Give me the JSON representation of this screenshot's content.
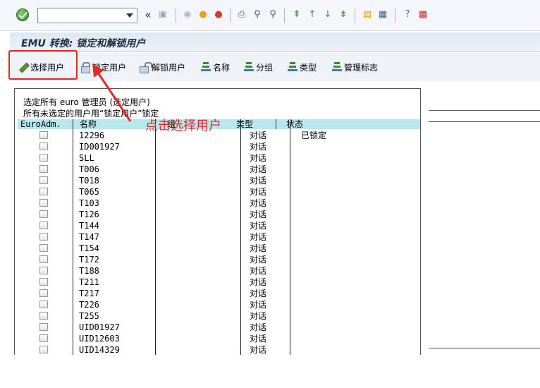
{
  "title": "EMU 转换: 锁定和解锁用户",
  "command_field": {
    "value": ""
  },
  "app_toolbar": {
    "select_users": "选择用户",
    "lock_users": "锁定用户",
    "unlock_users": "解锁用户",
    "sort_name": "名称",
    "sort_group": "分组",
    "sort_type": "类型",
    "admin_flag": "管理标志"
  },
  "list": {
    "info_line_1": "选定所有 euro 管理员 (选定用户)",
    "info_line_2": "所有未选定的用户用“锁定用户”锁定",
    "columns": {
      "euroadm": "EuroAdm.",
      "name": "名称",
      "group": "组",
      "type": "类型",
      "status": "状态"
    },
    "rows": [
      {
        "name": "12296",
        "type": "对话",
        "status": "已锁定"
      },
      {
        "name": "ID001927",
        "type": "对话",
        "status": ""
      },
      {
        "name": "SLL",
        "type": "对话",
        "status": ""
      },
      {
        "name": "T006",
        "type": "对话",
        "status": ""
      },
      {
        "name": "T018",
        "type": "对话",
        "status": ""
      },
      {
        "name": "T065",
        "type": "对话",
        "status": ""
      },
      {
        "name": "T103",
        "type": "对话",
        "status": ""
      },
      {
        "name": "T126",
        "type": "对话",
        "status": ""
      },
      {
        "name": "T144",
        "type": "对话",
        "status": ""
      },
      {
        "name": "T147",
        "type": "对话",
        "status": ""
      },
      {
        "name": "T154",
        "type": "对话",
        "status": ""
      },
      {
        "name": "T172",
        "type": "对话",
        "status": ""
      },
      {
        "name": "T188",
        "type": "对话",
        "status": ""
      },
      {
        "name": "T211",
        "type": "对话",
        "status": ""
      },
      {
        "name": "T217",
        "type": "对话",
        "status": ""
      },
      {
        "name": "T226",
        "type": "对话",
        "status": ""
      },
      {
        "name": "T255",
        "type": "对话",
        "status": ""
      },
      {
        "name": "UID01927",
        "type": "对话",
        "status": ""
      },
      {
        "name": "UID12603",
        "type": "对话",
        "status": ""
      },
      {
        "name": "UID14329",
        "type": "对话",
        "status": ""
      }
    ]
  },
  "annotation": {
    "text": "点击选择用户",
    "color": "#e02b2b"
  }
}
